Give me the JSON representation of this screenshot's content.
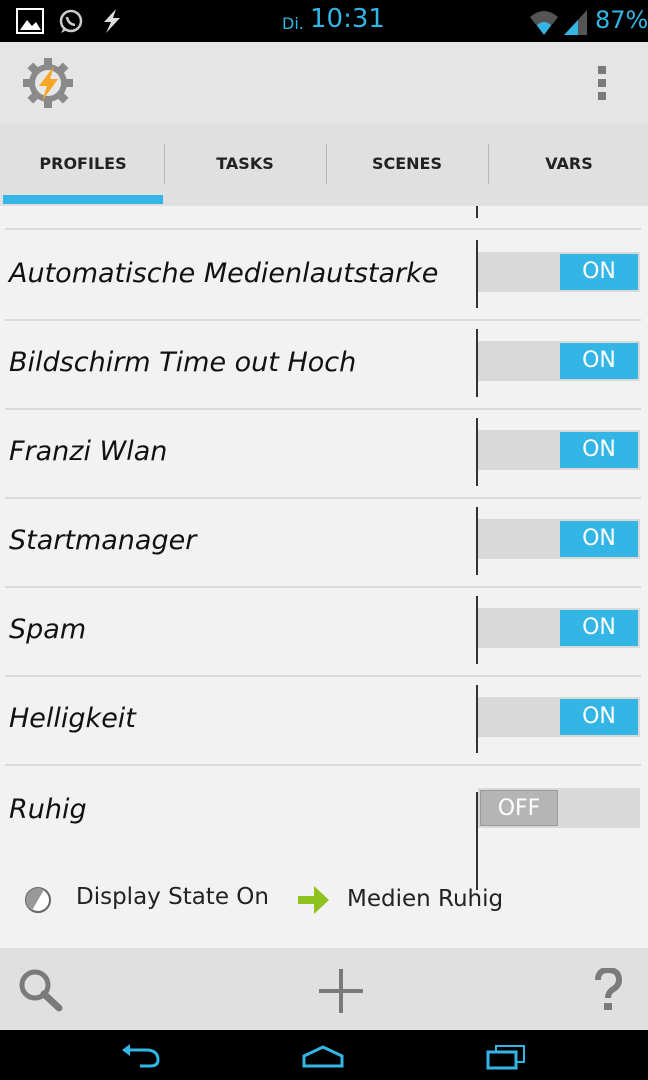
{
  "status_bar": {
    "day": "Di.",
    "time": "10:31",
    "battery": "87%",
    "icons": [
      "gallery-icon",
      "whatsapp-icon",
      "tasker-icon",
      "wifi-icon",
      "signal-icon"
    ]
  },
  "action_bar": {
    "app_icon": "tasker-gear-icon",
    "overflow_icon": "overflow-menu-icon"
  },
  "tabs": [
    {
      "label": "PROFILES",
      "selected": true
    },
    {
      "label": "TASKS"
    },
    {
      "label": "SCENES"
    },
    {
      "label": "VARS"
    }
  ],
  "profiles": [
    {
      "name": "Automatische Medienlautstarke",
      "state": "ON"
    },
    {
      "name": "Bildschirm Time out Hoch",
      "state": "ON"
    },
    {
      "name": "Franzi Wlan",
      "state": "ON"
    },
    {
      "name": "Startmanager",
      "state": "ON"
    },
    {
      "name": "Spam",
      "state": "ON"
    },
    {
      "name": "Helligkeit",
      "state": "ON"
    },
    {
      "name": "Ruhig",
      "state": "OFF"
    }
  ],
  "expanded_profile": {
    "context": "Display State On",
    "task": "Medien Ruhig"
  },
  "bottom_bar": {
    "icons": [
      "search-icon",
      "add-icon",
      "help-icon"
    ]
  },
  "nav_bar": {
    "icons": [
      "back-icon",
      "home-icon",
      "recents-icon"
    ]
  },
  "colors": {
    "accent": "#33b5e5",
    "arrow": "#8dc21f"
  }
}
